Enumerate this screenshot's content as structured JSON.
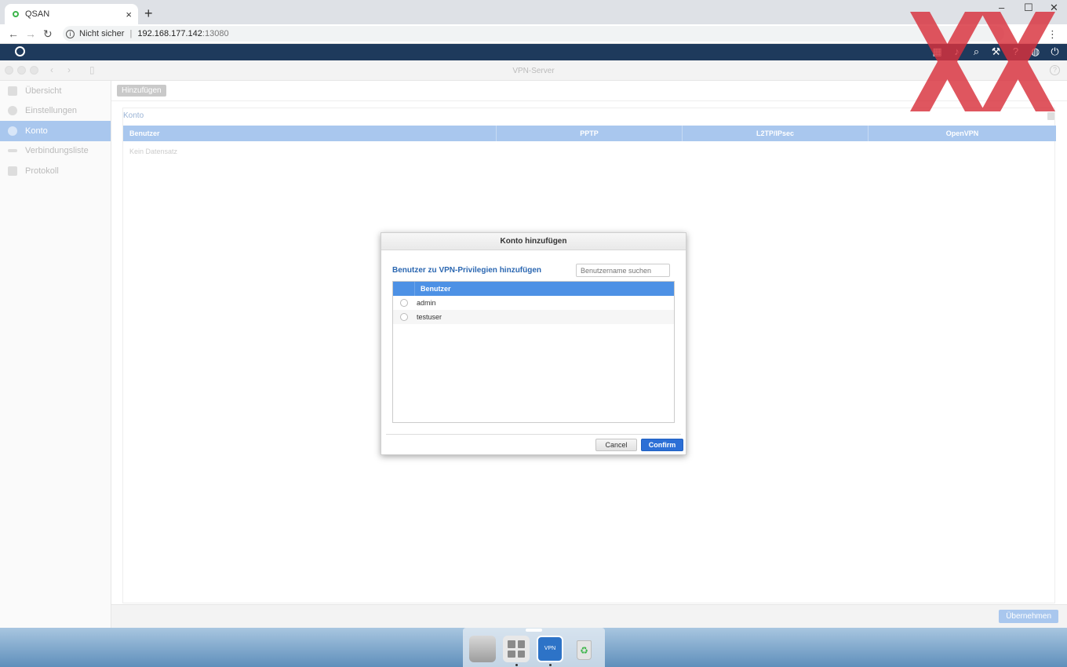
{
  "browser": {
    "tab_title": "QSAN",
    "tab_close": "×",
    "new_tab": "+",
    "security_label": "Nicht sicher",
    "host": "192.168.177.142",
    "port": ":13080",
    "menu": "⋮",
    "win_min": "–",
    "win_max": "☐",
    "win_close": "✕"
  },
  "app_header": {
    "icons": [
      "grid-icon",
      "bell-icon",
      "search-icon",
      "tool-icon",
      "help-icon",
      "globe-icon",
      "power-icon"
    ]
  },
  "window": {
    "title": "VPN-Server",
    "help": "?"
  },
  "sidebar": {
    "items": [
      {
        "label": "Übersicht",
        "icon": "overview-icon",
        "active": false
      },
      {
        "label": "Einstellungen",
        "icon": "settings-icon",
        "active": false
      },
      {
        "label": "Konto",
        "icon": "user-icon",
        "active": true
      },
      {
        "label": "Verbindungsliste",
        "icon": "connection-icon",
        "active": false
      },
      {
        "label": "Protokoll",
        "icon": "log-icon",
        "active": false
      }
    ]
  },
  "main": {
    "add_button": "Hinzufügen",
    "section_title": "Konto",
    "columns": [
      "Benutzer",
      "PPTP",
      "L2TP/IPsec",
      "OpenVPN"
    ],
    "empty_text": "Kein Datensatz",
    "apply_button": "Übernehmen"
  },
  "dialog": {
    "title": "Konto hinzufügen",
    "heading": "Benutzer zu VPN-Privilegien hinzufügen",
    "search_placeholder": "Benutzername suchen",
    "list_header": "Benutzer",
    "users": [
      "admin",
      "testuser"
    ],
    "cancel": "Cancel",
    "confirm": "Confirm"
  },
  "dock": {
    "vpn_label": "VPN"
  },
  "colors": {
    "header_bg": "#1e3a5c",
    "accent_blue": "#2c6fd6",
    "selected_blue": "#a9c7ee",
    "watermark_red": "#d9313d"
  }
}
